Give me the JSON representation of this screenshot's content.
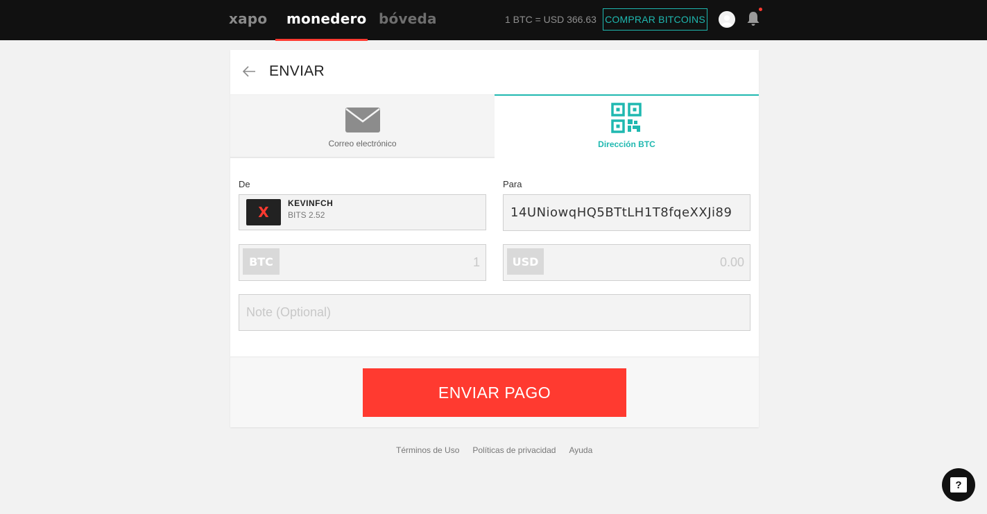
{
  "nav": {
    "xapo": "xapo",
    "monedero": "monedero",
    "boveda": "bóveda",
    "rate": "1 BTC = USD 366.63",
    "buy_label": "COMPRAR BITCOINS"
  },
  "card": {
    "title": "ENVIAR"
  },
  "tabs": [
    {
      "label": "Correo electrónico",
      "icon": "envelope-icon"
    },
    {
      "label": "Dirección BTC",
      "icon": "qr-code-icon",
      "active": true
    }
  ],
  "form": {
    "from_label": "De",
    "to_label": "Para",
    "from_logo": "X",
    "from_name": "KEVINFCH",
    "from_balance": "BITS 2.52",
    "to_value": "14UNiowqHQ5BTtLH1T8fqeXXJi89",
    "btc_tag": "BTC",
    "btc_placeholder": "1",
    "usd_tag": "USD",
    "usd_placeholder": "0.00",
    "note_placeholder": "Note (Optional)"
  },
  "send_label": "ENVIAR PAGO",
  "footer": {
    "terms": "Términos de Uso",
    "privacy": "Políticas de privacidad",
    "help": "Ayuda"
  },
  "help_bubble": "?",
  "colors": {
    "accent": "#1fb8b0",
    "primary": "#ff3a30",
    "nav_bg": "#111111"
  }
}
